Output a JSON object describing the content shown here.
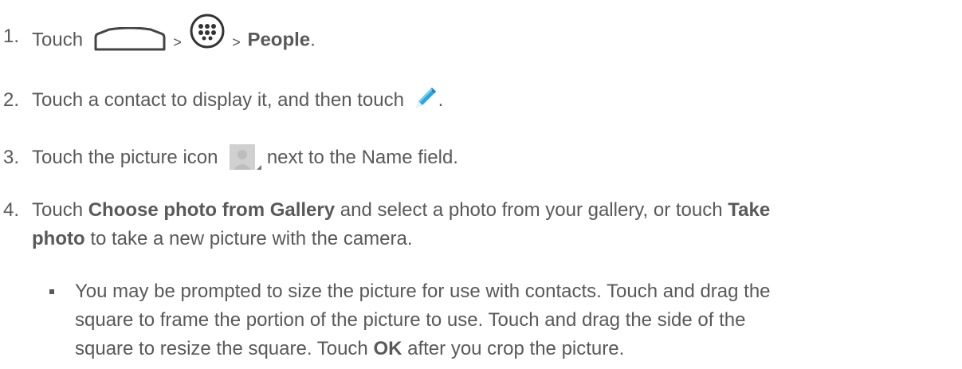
{
  "steps": [
    {
      "number": "1.",
      "text_touch": "Touch",
      "sep1": ">",
      "sep2": ">",
      "target": "People",
      "end": ".",
      "icons": [
        "home-outline-icon",
        "apps-grid-icon"
      ]
    },
    {
      "number": "2.",
      "text": "Touch a contact to display it, and then touch",
      "end": ".",
      "icons": [
        "edit-pencil-icon"
      ]
    },
    {
      "number": "3.",
      "text_before": "Touch the picture icon",
      "text_after": "next to the Name field.",
      "icons": [
        "contact-picture-icon"
      ]
    },
    {
      "number": "4.",
      "part1": "Touch",
      "part2": "Choose photo from Gallery",
      "part3": "and select a photo from your gallery, or touch",
      "part4": "Take",
      "part5": "photo",
      "part6": "to take a new picture with the camera."
    }
  ],
  "bullet": {
    "line1": "You may be prompted to size the picture for use with contacts. Touch and drag the",
    "line2": "square to frame the portion of the picture to use. Touch and drag the side of the",
    "line3_before": "square to resize the square. Touch",
    "line3_bold": "OK",
    "line3_after": "after you crop the picture."
  },
  "colors": {
    "text": "#595959",
    "pencil_blue": "#29a8e0",
    "contact_gray": "#c8c8c8"
  }
}
